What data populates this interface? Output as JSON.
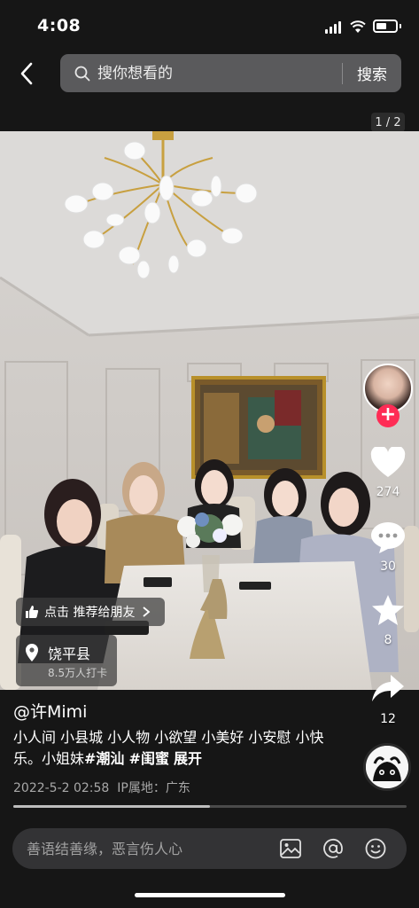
{
  "status_bar": {
    "time": "4:08"
  },
  "search": {
    "placeholder": "搜你想看的",
    "submit_label": "搜索"
  },
  "media": {
    "page_counter": "1 / 2"
  },
  "actions": {
    "likes": "274",
    "comments": "30",
    "favorites": "8",
    "shares": "12"
  },
  "overlay": {
    "recommend_label": "点击 推荐给朋友",
    "location_name": "饶平县",
    "location_checkins": "8.5万人打卡"
  },
  "post": {
    "author": "@许Mimi",
    "caption_text": "小人间 小县城 小人物 小欲望 小美好 小安慰 小快乐。小姐妹",
    "tags": [
      "#潮汕",
      "#闺蜜"
    ],
    "expand_label": "展开",
    "timestamp": "2022-5-2 02:58",
    "ip_location": "IP属地：广东",
    "progress": 0.5
  },
  "comment_bar": {
    "placeholder": "善语结善缘，恶言伤人心"
  },
  "colors": {
    "accent": "#fe2c55",
    "background": "#161616"
  }
}
